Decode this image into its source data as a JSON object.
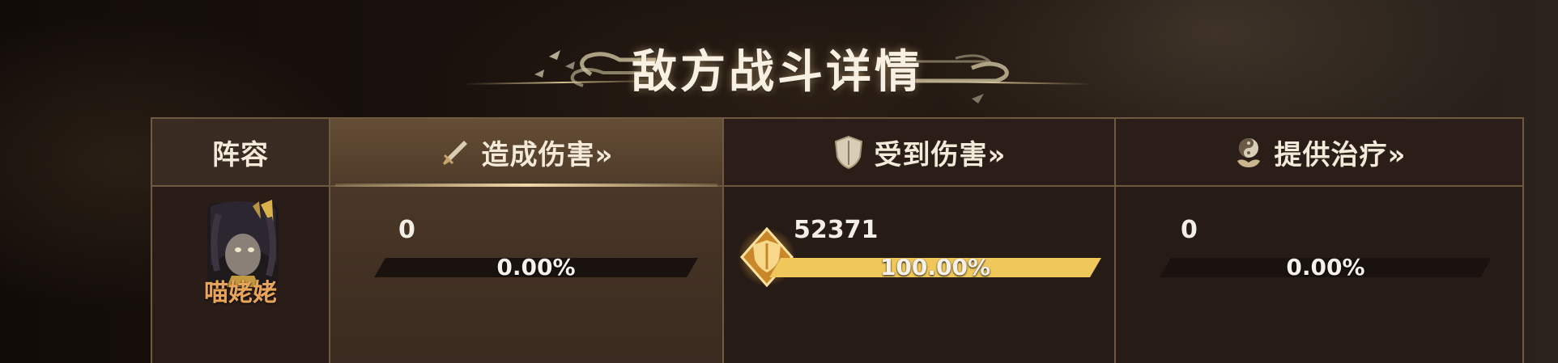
{
  "title": "敌方战斗详情",
  "colors": {
    "accent_gold": "#f0c75a",
    "border": "#6f5a40",
    "hero_name": "#e7a45a"
  },
  "headers": {
    "lineup": "阵容",
    "damage_dealt": "造成伤害»",
    "damage_taken": "受到伤害»",
    "healing": "提供治疗»"
  },
  "icons": {
    "damage_dealt": "sword-icon",
    "damage_taken": "shield-icon",
    "healing": "yin-yang-lotus-icon"
  },
  "row": {
    "hero_name": "喵姥姥",
    "damage_dealt": {
      "value": "0",
      "percent_text": "0.00%",
      "fraction": 0
    },
    "damage_taken": {
      "value": "52371",
      "percent_text": "100.00%",
      "fraction": 1
    },
    "healing": {
      "value": "0",
      "percent_text": "0.00%",
      "fraction": 0
    }
  }
}
